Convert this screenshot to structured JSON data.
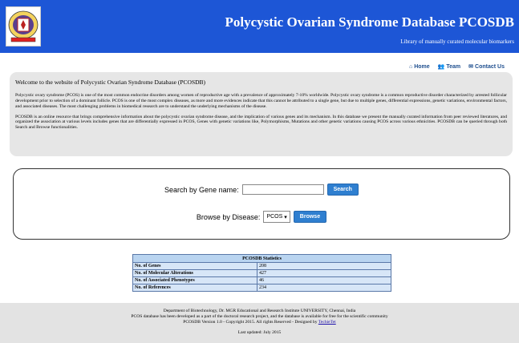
{
  "header": {
    "title": "Polycystic Ovarian Syndrome Database PCOSDB",
    "subtitle": "Library of manually curated molecular biomarkers",
    "logo_icon": "university-crest-logo"
  },
  "nav": {
    "home": "Home",
    "team": "Team",
    "contact": "Contact Us"
  },
  "welcome": {
    "heading": "Welcome to the website of Polycystic Ovarian Syndrome Database (PCOSDB)",
    "para1": "Polycystic ovary syndrome (PCOS) is one of the most common endocrine disorders among women of reproductive age with a prevalence of approximately 7-10% worldwide. Polycystic ovary syndrome is a common reproductive disorder characterized by arrested follicular development prior to selection of a dominant follicle. PCOS is one of the most complex diseases, as more and more evidences indicate that this cannot be attributed to a single gene, but due to multiple genes, differential expressions, genetic variations, environmental factors, and associated diseases. The most challenging problems in biomedical research are to understand the underlying mechanisms of the disease.",
    "para2": "PCOSDB is an online resource that brings comprehensive information about the polycystic ovarian syndrome disease, and the implication of various genes and its mechanism. In this database we present the manually curated information from peer reviewed literatures, and organized the association at various levels includes genes that are differentially expressed in PCOS, Genes with genetic variations like, Polymorphisms, Mutations and other genetic variations causing PCOS across various ethnicities. PCOSDB can be queried through both Search and Browse functionalities."
  },
  "search": {
    "gene_label": "Search by Gene name:",
    "gene_value": "",
    "search_button": "Search",
    "disease_label": "Browse by Disease:",
    "disease_selected": "PCOS",
    "browse_button": "Browse"
  },
  "stats": {
    "title": "PCOSDB Statistics",
    "rows": [
      {
        "label": "No. of Genes",
        "value": "208"
      },
      {
        "label": "No. of Molecular Alterations",
        "value": "427"
      },
      {
        "label": "No. of Associated Phenotypes",
        "value": "46"
      },
      {
        "label": "No. of References",
        "value": "234"
      }
    ]
  },
  "footer": {
    "line1": "Department of Biotechnology, Dr. MGR Educational and Research Institute UNIVERSITY, Chennai, India",
    "line2": "PCOS database has been developed as a part of the doctoral research project, and the database is available for free for the scientific community",
    "line3_prefix": "PCOSDB Version 1.0 - Copyright 2015. All rights Reserved - Designed by",
    "designer_link": "TechieTet",
    "updated": "Last updated: July 2015"
  },
  "colors": {
    "header_bg": "#1d56d6",
    "button_bg": "#2f7fd0",
    "table_header": "#b9d4f0",
    "table_cell": "#d7e6f7"
  }
}
